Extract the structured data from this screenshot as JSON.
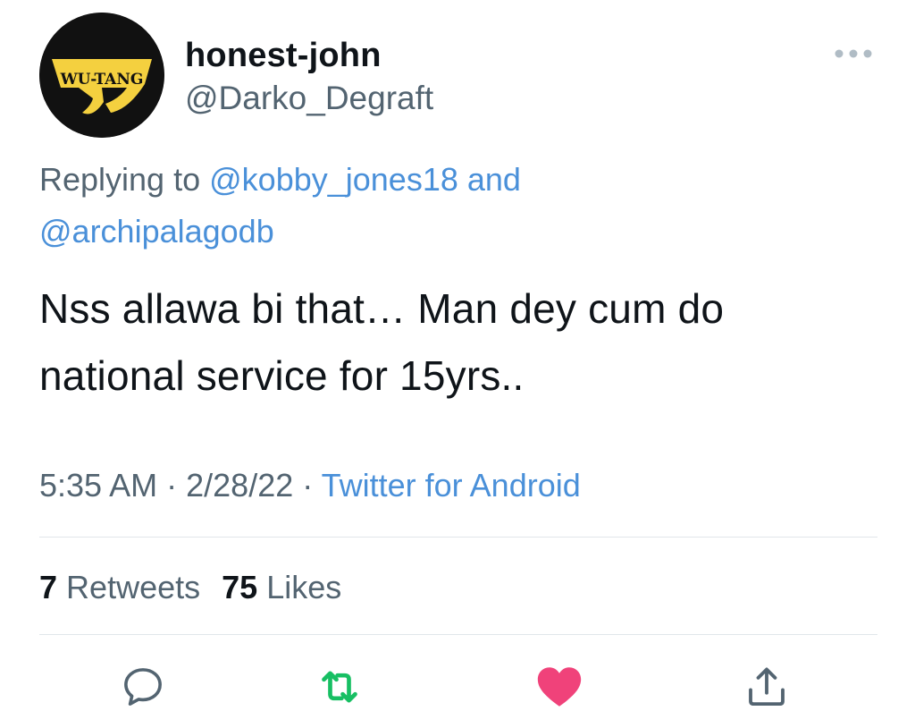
{
  "tweet": {
    "display_name": "honest-john",
    "handle": "@Darko_Degraft",
    "avatar_text": "WU-TANG",
    "replying_prefix": "Replying to",
    "reply_mention_1": "@kobby_jones18",
    "reply_connector": "and",
    "reply_mention_2": "@archipalagodb",
    "text": "Nss allawa bi that… Man dey cum do national service for 15yrs..",
    "time": "5:35 AM",
    "separator": "·",
    "date": "2/28/22",
    "source": "Twitter for Android",
    "retweets_count": "7",
    "retweets_label": "Retweets",
    "likes_count": "75",
    "likes_label": "Likes"
  },
  "actions": {
    "reply_icon": "reply-icon",
    "retweet_icon": "retweet-icon",
    "like_icon": "heart-icon",
    "share_icon": "share-icon"
  },
  "colors": {
    "link": "#4a90d9",
    "secondary_text": "#536471",
    "retweet_green": "#17bf63",
    "like_pink": "#f0427a",
    "avatar_yellow": "#f4d03f"
  }
}
